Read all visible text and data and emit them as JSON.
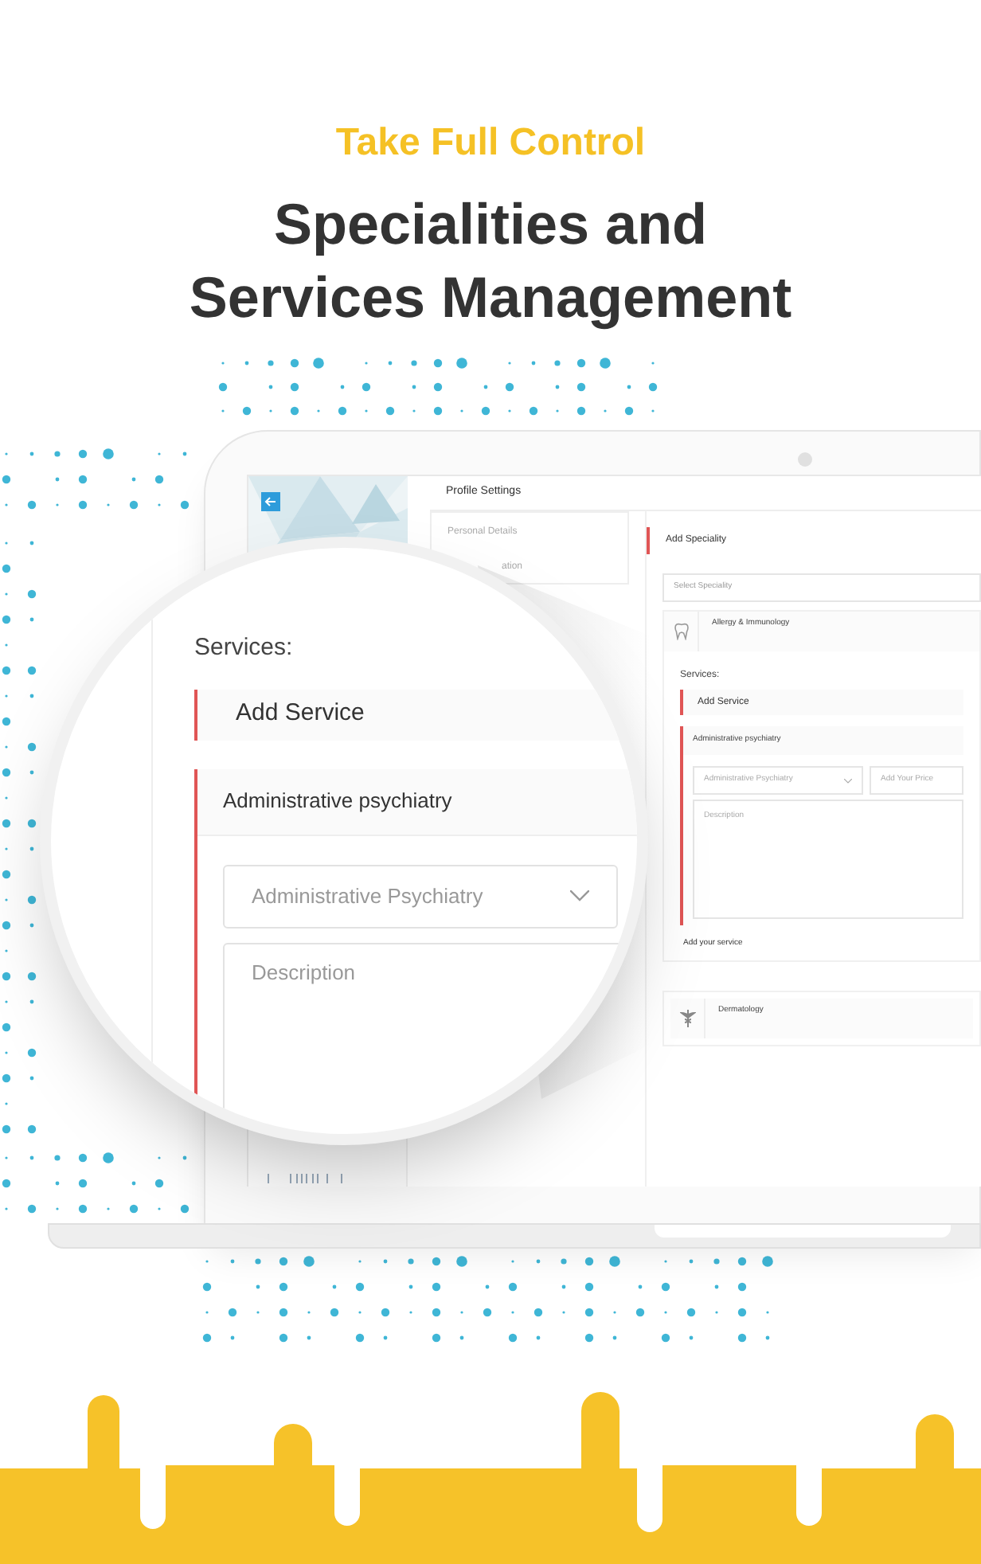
{
  "header": {
    "eyebrow": "Take Full Control",
    "title": "Specialities and Services Management"
  },
  "screen": {
    "page_title": "Profile Settings",
    "menu": [
      {
        "label": "Personal Details"
      },
      {
        "label": "ation"
      }
    ],
    "add_speciality": "Add Speciality",
    "speciality_select": {
      "placeholder": "Select Speciality"
    },
    "specialities": [
      {
        "name": "Allergy & Immunology",
        "kind": "tooth",
        "services_label": "Services:",
        "add_service": "Add Service",
        "services": [
          {
            "title": "Administrative psychiatry",
            "select_value": "Administrative Psychiatry",
            "price": {
              "placeholder": "Add Your Price"
            },
            "description": {
              "placeholder": "Description"
            }
          }
        ],
        "add_your_service": "Add your service"
      },
      {
        "name": "Dermatology",
        "kind": "caduceus"
      }
    ]
  },
  "magnifier": {
    "services_label": "Services:",
    "add_service": "Add Service",
    "service_title": "Administrative psychiatry",
    "select_value": "Administrative Psychiatry",
    "description": {
      "placeholder": "Description"
    }
  }
}
